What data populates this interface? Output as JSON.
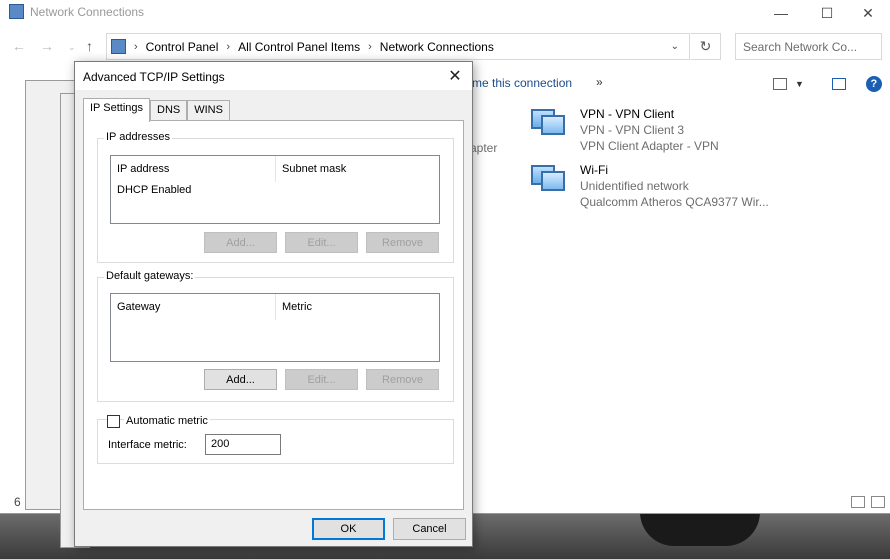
{
  "explorer": {
    "title": "Network Connections",
    "window_controls": {
      "minimize": "—",
      "maximize": "☐",
      "close": "✕"
    },
    "breadcrumb": [
      "Control Panel",
      "All Control Panel Items",
      "Network Connections"
    ],
    "search_placeholder": "Search Network Co...",
    "cmd_rename": "me this connection",
    "cmd_more": "»",
    "connections": [
      {
        "name": "VPN - VPN Client",
        "status": "VPN - VPN Client 3",
        "device": "VPN Client Adapter - VPN"
      },
      {
        "name": "Wi-Fi",
        "status": "Unidentified network",
        "device": "Qualcomm Atheros QCA9377 Wir..."
      }
    ],
    "partial_text": "apter",
    "item_count": "6"
  },
  "dialog": {
    "title": "Advanced TCP/IP Settings",
    "tabs": [
      "IP Settings",
      "DNS",
      "WINS"
    ],
    "ip_group": {
      "label": "IP addresses",
      "columns": [
        "IP address",
        "Subnet mask"
      ],
      "rows": [
        "DHCP Enabled"
      ],
      "buttons": {
        "add": "Add...",
        "edit": "Edit...",
        "remove": "Remove"
      }
    },
    "gateway_group": {
      "label": "Default gateways:",
      "columns": [
        "Gateway",
        "Metric"
      ],
      "buttons": {
        "add": "Add...",
        "edit": "Edit...",
        "remove": "Remove"
      }
    },
    "metric": {
      "auto_label": "Automatic metric",
      "auto_checked": false,
      "interface_label": "Interface metric:",
      "interface_value": "200"
    },
    "ok": "OK",
    "cancel": "Cancel"
  }
}
